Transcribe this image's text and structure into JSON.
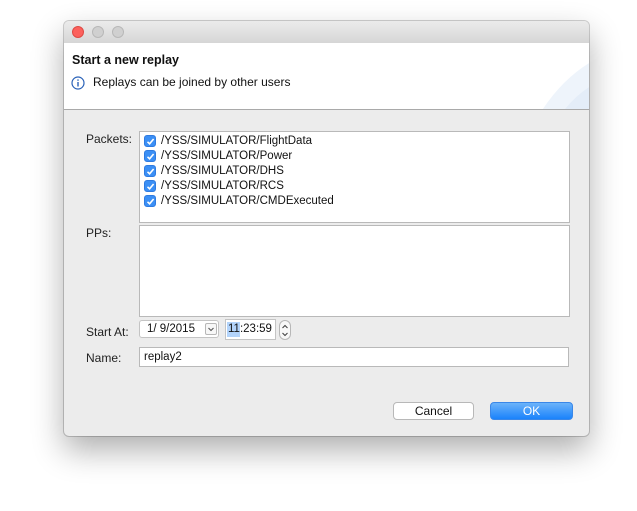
{
  "window": {
    "title": ""
  },
  "banner": {
    "title": "Start a new replay",
    "message": "Replays can be joined by other users",
    "info_icon": "info-icon"
  },
  "form": {
    "packets_label": "Packets:",
    "packets": [
      {
        "label": "/YSS/SIMULATOR/FlightData",
        "checked": true
      },
      {
        "label": "/YSS/SIMULATOR/Power",
        "checked": true
      },
      {
        "label": "/YSS/SIMULATOR/DHS",
        "checked": true
      },
      {
        "label": "/YSS/SIMULATOR/RCS",
        "checked": true
      },
      {
        "label": "/YSS/SIMULATOR/CMDExecuted",
        "checked": true
      }
    ],
    "pps_label": "PPs:",
    "start_at_label": "Start At:",
    "start_date": "1/  9/2015",
    "start_time_highlight": "11",
    "start_time_rest": ":23:59",
    "name_label": "Name:",
    "name_value": "replay2"
  },
  "buttons": {
    "cancel": "Cancel",
    "ok": "OK"
  },
  "colors": {
    "accent": "#1a82fb",
    "checkbox": "#3b8ff5",
    "close": "#fc615d"
  }
}
